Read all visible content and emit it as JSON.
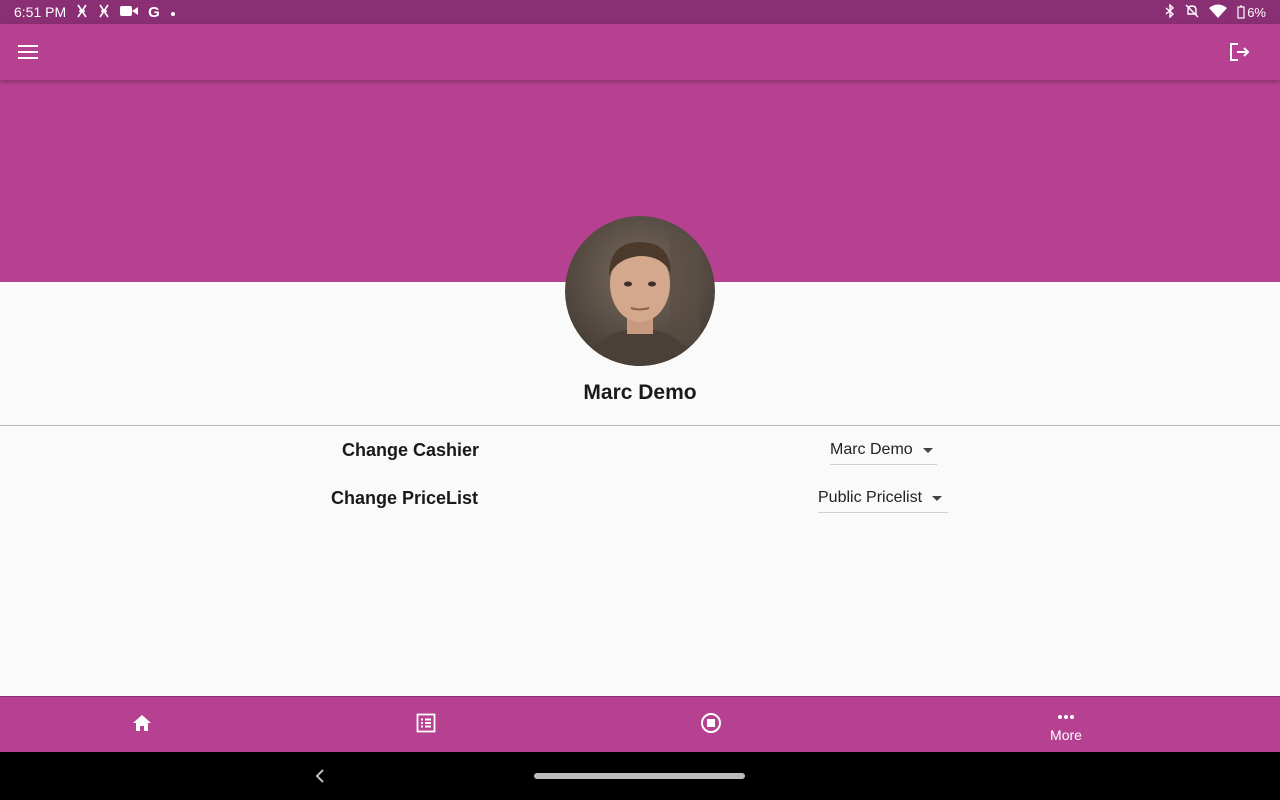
{
  "status_bar": {
    "time": "6:51 PM",
    "notification_icons": [
      "fitness-icon",
      "fitness-icon",
      "video-icon",
      "google-icon",
      "dot-icon"
    ],
    "system_icons": [
      "bluetooth-icon",
      "mute-icon",
      "wifi-icon",
      "battery-icon"
    ],
    "battery": "6%"
  },
  "app_bar": {
    "menu_icon": "menu-icon",
    "logout_icon": "logout-icon"
  },
  "profile": {
    "name": "Marc Demo",
    "avatar": "avatar-photo"
  },
  "settings": {
    "cashier_label": "Change Cashier",
    "cashier_value": "Marc Demo",
    "pricelist_label": "Change PriceList",
    "pricelist_value": "Public Pricelist"
  },
  "bottom_nav": {
    "items": [
      {
        "icon": "home-icon",
        "label": ""
      },
      {
        "icon": "list-icon",
        "label": ""
      },
      {
        "icon": "stop-circle-icon",
        "label": ""
      },
      {
        "icon": "more-icon",
        "label": "More"
      }
    ]
  },
  "colors": {
    "primary": "#b74191",
    "status_bar": "#8b2f74",
    "background": "#fafafa"
  }
}
